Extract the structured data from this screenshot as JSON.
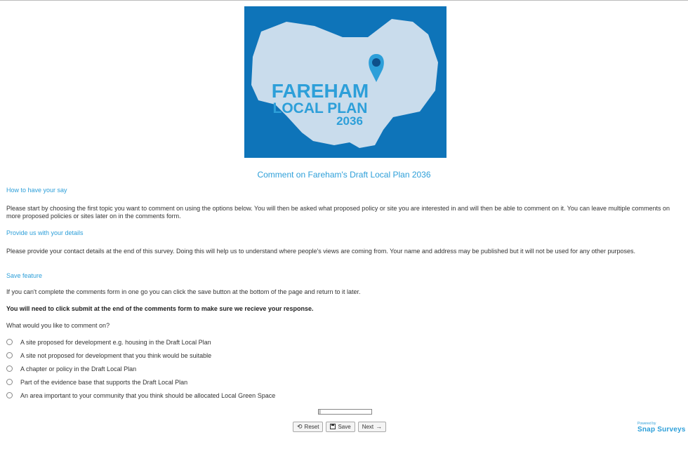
{
  "header": {
    "logo": {
      "line1": "FAREHAM",
      "line2": "LOCAL PLAN",
      "line3": "2036"
    },
    "title": "Comment on Fareham's Draft Local Plan 2036"
  },
  "sections": [
    {
      "heading": "How to have your say",
      "body": "Please start by choosing the first topic you want to comment on using the options below. You will then be asked what proposed policy or site you are interested in and will then be able to comment on it.  You can leave multiple comments on more proposed policies or sites later on in the comments form."
    },
    {
      "heading": "Provide us with your details",
      "body": "Please provide your contact details at the end of this survey.  Doing this will help us to understand where people's views are coming from. Your name and address may be published but it will not be used for any other purposes."
    },
    {
      "heading": "Save feature",
      "body": "If you can't complete the comments form in one go you can click the save button at the bottom of the page and return to it later."
    }
  ],
  "notice": "You will need to click submit at the end of the comments form to make sure we recieve your response.",
  "question": {
    "text": "What would you like to comment on?",
    "options": [
      "A site proposed for development e.g. housing in the Draft Local Plan",
      "A site not proposed for development that you think would be suitable",
      "A chapter or policy in the Draft Local Plan",
      "Part of the evidence base that supports the Draft Local Plan",
      "An area important to your community that you think should be allocated Local Green Space"
    ]
  },
  "progress": {
    "fraction": 0.04
  },
  "buttons": {
    "reset": "Reset",
    "save": "Save",
    "next": "Next"
  },
  "footer": {
    "powered_by": "Powered by",
    "brand": "Snap Surveys"
  },
  "colors": {
    "accent": "#2d9fd9",
    "logo_bg": "#0e74b9",
    "logo_map": "#c9dcec"
  }
}
